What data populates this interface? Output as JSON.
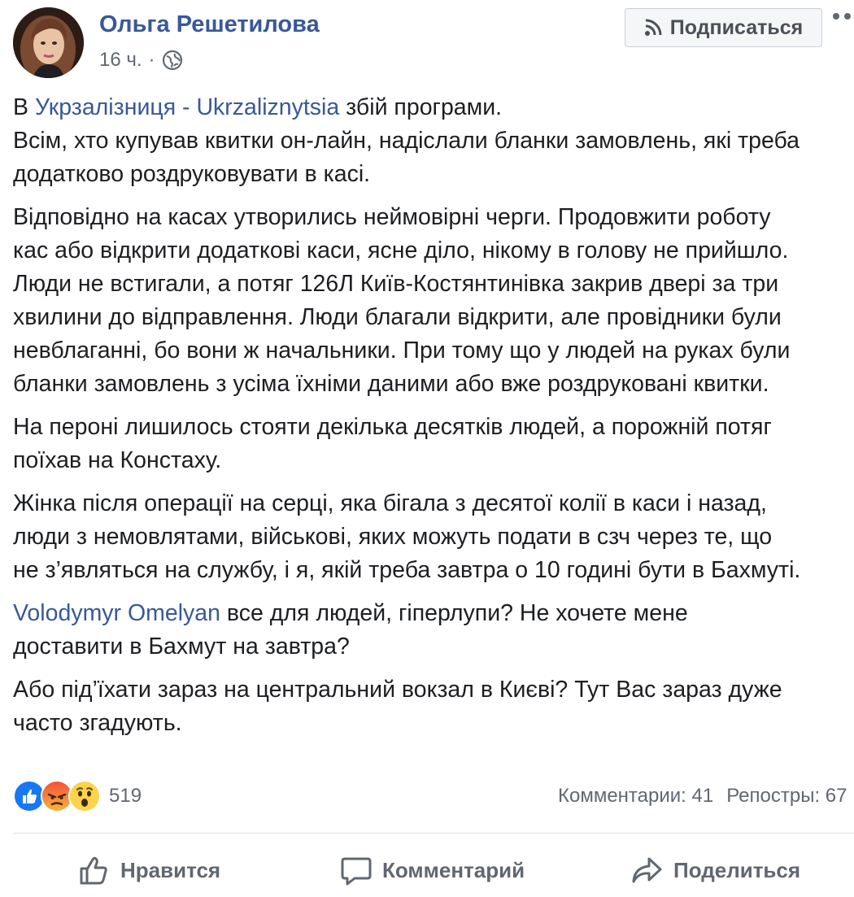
{
  "author": {
    "name": "Ольга Решетилова",
    "time": "16 ч.",
    "separator": "·",
    "privacy_icon": "globe-icon"
  },
  "header": {
    "subscribe_label": "Подписаться",
    "subscribe_icon": "rss-icon",
    "more_icon": "more-dots-icon"
  },
  "post": {
    "p1": {
      "prefix": "В ",
      "link": "Укрзалізниця - Ukrzaliznytsia",
      "suffix": " збій програми.",
      "line2": "Всім, хто купував квитки он-лайн, надіслали бланки замовлень, які треба",
      "line3": "додатково роздруковувати в касі."
    },
    "p2": {
      "line1": "Відповідно на касах утворились неймовірні черги. Продовжити роботу",
      "line2": "кас або відкрити додаткові каси, ясне діло, нікому в голову не прийшло.",
      "line3": "Люди не встигали, а потяг 126Л Київ-Костянтинівка закрив двері за три",
      "line4": "хвилини до відправлення. Люди благали відкрити, але провідники були",
      "line5": "невблаганні, бо вони ж начальники. При тому що у людей на руках були",
      "line6": "бланки замовлень з усіма їхніми даними або вже роздруковані квитки."
    },
    "p3": {
      "line1": "На пероні лишилось стояти декілька десятків людей, а порожній потяг",
      "line2": "поїхав на Констаху."
    },
    "p4": {
      "line1": "Жінка після операції на серці, яка бігала з десятої колії в каси і назад,",
      "line2": "люди з немовлятами, військові, яких можуть подати в сзч через те, що",
      "line3": "не з’являться на службу, і я, якій треба завтра о 10 годині бути в Бахмуті."
    },
    "p5": {
      "link": "Volodymyr Omelyan",
      "suffix": " все для людей, гіперлупи? Не хочете мене",
      "line2": "доставити в Бахмут на завтра?"
    },
    "p6": {
      "line1": "Або під’їхати зараз на центральний вокзал в Києві? Тут Вас зараз дуже",
      "line2": "часто згадують."
    }
  },
  "stats": {
    "reaction_icons": [
      "like-icon",
      "angry-icon",
      "wow-icon"
    ],
    "reactions_count": "519",
    "comments": "Комментарии: 41",
    "reposts": "Репостры: 67"
  },
  "actions": {
    "like": "Нравится",
    "comment": "Комментарий",
    "share": "Поделиться"
  },
  "colors": {
    "link": "#385898",
    "text": "#1c1e21",
    "muted": "#616770",
    "like_blue": "#1877f2",
    "angry_top": "#f2523a",
    "wow_yellow": "#fcd34d"
  }
}
